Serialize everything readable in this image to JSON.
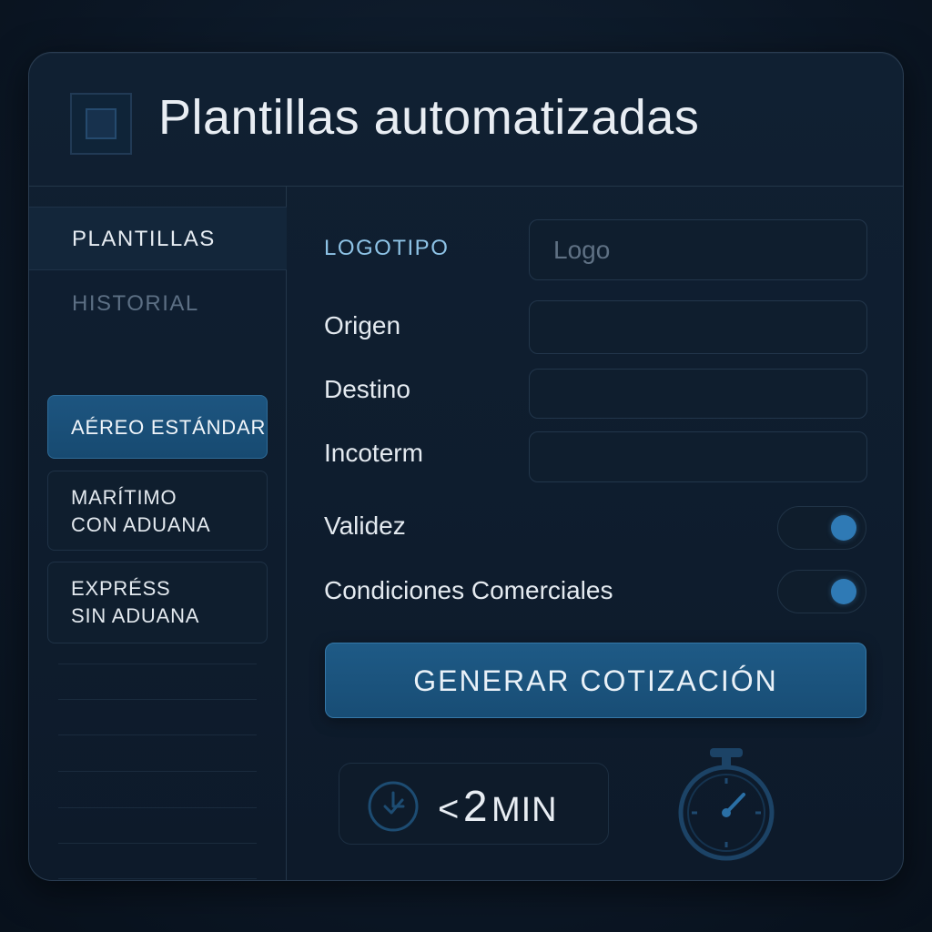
{
  "header": {
    "title": "Plantillas automatizadas",
    "logo_icon": "app-square-icon"
  },
  "sidebar": {
    "nav": [
      {
        "label": "PLANTILLAS",
        "selected": true
      },
      {
        "label": "HISTORIAL",
        "selected": false
      }
    ],
    "templates": [
      {
        "label": "AÉREO ESTÁNDAR",
        "active": true
      },
      {
        "label": "MARÍTIMO\nCON ADUANA",
        "active": false
      },
      {
        "label": "EXPRÉSS\nSIN ADUANA",
        "active": false
      }
    ]
  },
  "form": {
    "logotipo": {
      "label": "LOGOTIPO",
      "placeholder": "Logo"
    },
    "origen": {
      "label": "Origen",
      "value": ""
    },
    "destino": {
      "label": "Destino",
      "value": ""
    },
    "incoterm": {
      "label": "Incoterm",
      "value": ""
    },
    "validez": {
      "label": "Validez",
      "enabled": true
    },
    "condiciones": {
      "label": "Condiciones Comerciales",
      "enabled": true
    },
    "generate_label": "GENERAR COTIZACIÓN"
  },
  "timer": {
    "prefix": "<",
    "value": "2",
    "unit": "MIN",
    "icon": "clock-icon",
    "decoration_icon": "stopwatch-icon"
  },
  "colors": {
    "accent": "#2f7ab5",
    "button": "#1e5a86",
    "background": "#0d1a2a",
    "label_accent": "#8ec3e6"
  }
}
